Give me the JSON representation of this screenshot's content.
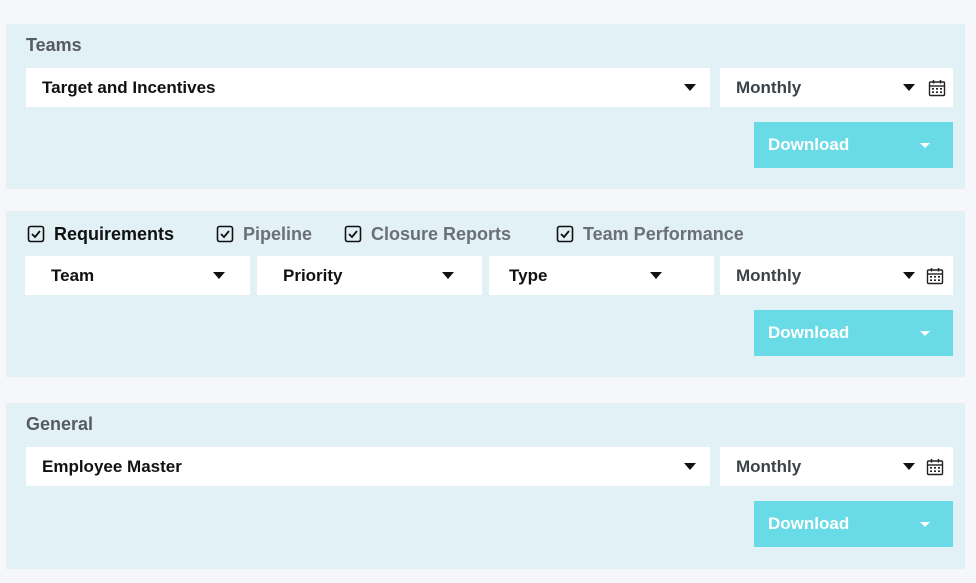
{
  "colors": {
    "panel_bg": "#e1f1f5",
    "page_bg": "#f5f7fa",
    "download_bg": "#69dbe6",
    "text_dark": "#111111",
    "text_muted": "#6a7075"
  },
  "teams": {
    "title": "Teams",
    "report_select": "Target and Incentives",
    "period_select": "Monthly",
    "calendar_icon": "calendar-icon",
    "download_label": "Download"
  },
  "requirements": {
    "tabs": [
      {
        "label": "Requirements",
        "checked": true,
        "active": true
      },
      {
        "label": "Pipeline",
        "checked": true,
        "active": false
      },
      {
        "label": "Closure Reports",
        "checked": true,
        "active": false
      },
      {
        "label": "Team Performance",
        "checked": true,
        "active": false
      }
    ],
    "filters": {
      "team": "Team",
      "priority": "Priority",
      "type": "Type"
    },
    "period_select": "Monthly",
    "download_label": "Download"
  },
  "general": {
    "title": "General",
    "report_select": "Employee Master",
    "period_select": "Monthly",
    "download_label": "Download"
  }
}
